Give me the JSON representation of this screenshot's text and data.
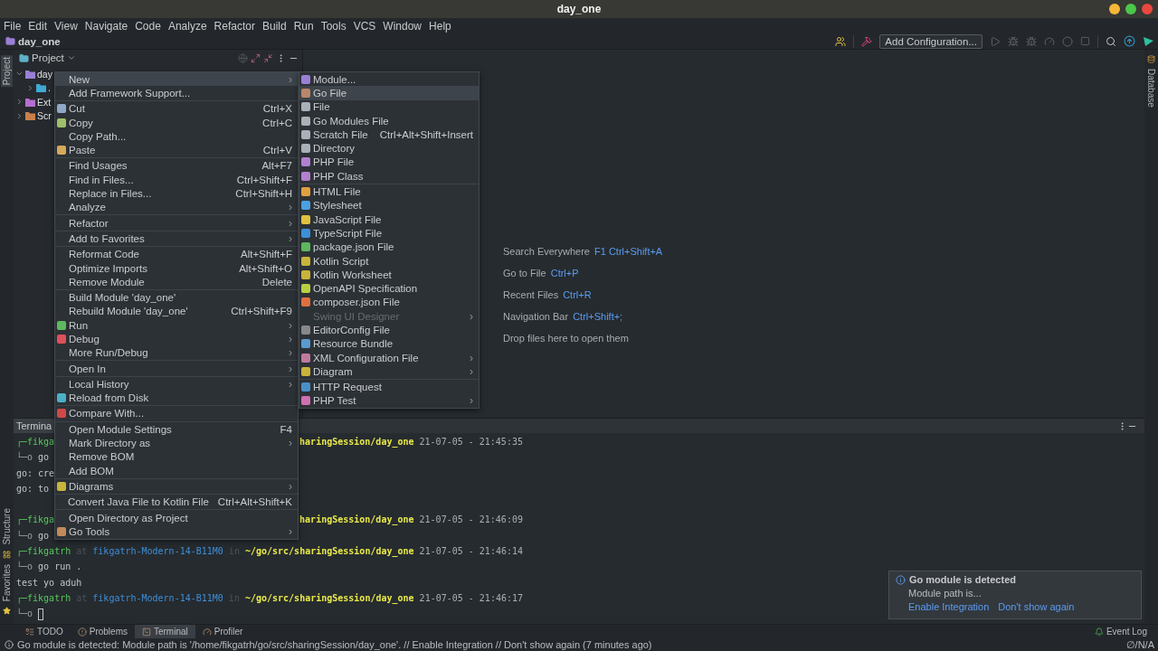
{
  "window": {
    "title": "day_one"
  },
  "menubar": [
    "File",
    "Edit",
    "View",
    "Navigate",
    "Code",
    "Analyze",
    "Refactor",
    "Build",
    "Run",
    "Tools",
    "VCS",
    "Window",
    "Help"
  ],
  "navbar": {
    "project": "day_one",
    "run_config": "Add Configuration..."
  },
  "left_strip": {
    "top": [
      {
        "label": "Project",
        "selected": true
      }
    ],
    "bottom": [
      {
        "label": "Structure",
        "selected": false
      },
      {
        "label": "Favorites",
        "selected": false
      }
    ]
  },
  "right_strip": [
    "Database"
  ],
  "project_panel": {
    "title": "Project",
    "tree": [
      {
        "label": "day",
        "expanded": true,
        "color": "#9a7fd6",
        "children": [
          {
            "label": ".",
            "expanded": false,
            "color": "#3fa9d6"
          }
        ]
      },
      {
        "label": "Ext",
        "expanded": false,
        "color": "#b56fd0"
      },
      {
        "label": "Scr",
        "expanded": false,
        "color": "#c87f4a"
      }
    ]
  },
  "editor_hints": [
    {
      "action": "Search Everywhere",
      "shortcut": "F1 Ctrl+Shift+A"
    },
    {
      "action": "Go to File",
      "shortcut": "Ctrl+P"
    },
    {
      "action": "Recent Files",
      "shortcut": "Ctrl+R"
    },
    {
      "action": "Navigation Bar",
      "shortcut": "Ctrl+Shift+;"
    },
    {
      "action": "Drop files here to open them"
    }
  ],
  "terminal": {
    "title": "Termina",
    "lines": [
      {
        "kind": "cut_prompt",
        "left": "┌─fikga",
        "path": "haringSession/day_one",
        "time": "21-07-05 - 21:45:35"
      },
      {
        "kind": "command",
        "prompt": "└─o",
        "text": "go"
      },
      {
        "kind": "output",
        "text": "go: cre"
      },
      {
        "kind": "output",
        "text": "go: to"
      },
      {
        "kind": "blank"
      },
      {
        "kind": "cut_prompt",
        "left": "┌─fikga",
        "path": "haringSession/day_one",
        "time": "21-07-05 - 21:46:09"
      },
      {
        "kind": "command",
        "prompt": "└─o",
        "text": "go"
      },
      {
        "kind": "prompt",
        "user": "┌─fikgatrh",
        "at": "at",
        "host": "fikgatrh-Modern-14-B11M0",
        "in": "in",
        "path": "~/go/src/sharingSession/day_one",
        "time": "21-07-05 - 21:46:14"
      },
      {
        "kind": "command",
        "prompt": "└─o",
        "text": "go run ."
      },
      {
        "kind": "output",
        "text": "test yo aduh"
      },
      {
        "kind": "prompt",
        "user": "┌─fikgatrh",
        "at": "at",
        "host": "fikgatrh-Modern-14-B11M0",
        "in": "in",
        "path": "~/go/src/sharingSession/day_one",
        "time": "21-07-05 - 21:46:17"
      },
      {
        "kind": "cursor",
        "prompt": "└─o"
      }
    ]
  },
  "context_menu": {
    "items": [
      {
        "kind": "item",
        "label": "New",
        "selected": true,
        "arrow": "›"
      },
      {
        "kind": "item",
        "label": "Add Framework Support...",
        "selected": false
      },
      {
        "kind": "separator"
      },
      {
        "kind": "item",
        "label": "Cut",
        "selected": false,
        "shortcut": "Ctrl+X",
        "color": "#8fa8c8"
      },
      {
        "kind": "item",
        "label": "Copy",
        "selected": false,
        "shortcut": "Ctrl+C",
        "color": "#9fbf6a"
      },
      {
        "kind": "item",
        "label": "Copy Path...",
        "selected": false
      },
      {
        "kind": "item",
        "label": "Paste",
        "selected": false,
        "shortcut": "Ctrl+V",
        "color": "#d6a85a"
      },
      {
        "kind": "separator"
      },
      {
        "kind": "item",
        "label": "Find Usages",
        "selected": false,
        "shortcut": "Alt+F7"
      },
      {
        "kind": "item",
        "label": "Find in Files...",
        "selected": false,
        "shortcut": "Ctrl+Shift+F"
      },
      {
        "kind": "item",
        "label": "Replace in Files...",
        "selected": false,
        "shortcut": "Ctrl+Shift+H"
      },
      {
        "kind": "item",
        "label": "Analyze",
        "selected": false,
        "arrow": "›"
      },
      {
        "kind": "separator"
      },
      {
        "kind": "item",
        "label": "Refactor",
        "selected": false,
        "arrow": "›"
      },
      {
        "kind": "separator"
      },
      {
        "kind": "item",
        "label": "Add to Favorites",
        "selected": false,
        "arrow": "›"
      },
      {
        "kind": "separator"
      },
      {
        "kind": "item",
        "label": "Reformat Code",
        "selected": false,
        "shortcut": "Alt+Shift+F"
      },
      {
        "kind": "item",
        "label": "Optimize Imports",
        "selected": false,
        "shortcut": "Alt+Shift+O"
      },
      {
        "kind": "item",
        "label": "Remove Module",
        "selected": false,
        "shortcut": "Delete"
      },
      {
        "kind": "separator"
      },
      {
        "kind": "item",
        "label": "Build Module 'day_one'",
        "selected": false
      },
      {
        "kind": "item",
        "label": "Rebuild Module 'day_one'",
        "selected": false,
        "shortcut": "Ctrl+Shift+F9"
      },
      {
        "kind": "item",
        "label": "Run",
        "selected": false,
        "arrow": "›",
        "color": "#5fb85f"
      },
      {
        "kind": "item",
        "label": "Debug",
        "selected": false,
        "arrow": "›",
        "color": "#e0505a"
      },
      {
        "kind": "item",
        "label": "More Run/Debug",
        "selected": false,
        "arrow": "›"
      },
      {
        "kind": "separator"
      },
      {
        "kind": "item",
        "label": "Open In",
        "selected": false,
        "arrow": "›"
      },
      {
        "kind": "separator"
      },
      {
        "kind": "item",
        "label": "Local History",
        "selected": false,
        "arrow": "›"
      },
      {
        "kind": "item",
        "label": "Reload from Disk",
        "selected": false,
        "color": "#4bb0c8"
      },
      {
        "kind": "separator"
      },
      {
        "kind": "item",
        "label": "Compare With...",
        "selected": false,
        "color": "#d04848"
      },
      {
        "kind": "separator"
      },
      {
        "kind": "item",
        "label": "Open Module Settings",
        "selected": false,
        "shortcut": "F4"
      },
      {
        "kind": "item",
        "label": "Mark Directory as",
        "selected": false,
        "arrow": "›"
      },
      {
        "kind": "item",
        "label": "Remove BOM",
        "selected": false
      },
      {
        "kind": "item",
        "label": "Add BOM",
        "selected": false
      },
      {
        "kind": "separator"
      },
      {
        "kind": "item",
        "label": "Diagrams",
        "selected": false,
        "arrow": "›",
        "color": "#c8b43a"
      },
      {
        "kind": "separator"
      },
      {
        "kind": "item",
        "label": "Convert Java File to Kotlin File",
        "selected": false,
        "shortcut": "Ctrl+Alt+Shift+K"
      },
      {
        "kind": "separator"
      },
      {
        "kind": "item",
        "label": "Open Directory as Project",
        "selected": false
      },
      {
        "kind": "item",
        "label": "Go Tools",
        "selected": false,
        "arrow": "›",
        "color": "#c08a5a"
      }
    ]
  },
  "new_submenu": {
    "items": [
      {
        "kind": "item",
        "label": "Module...",
        "selected": false,
        "disabled": false,
        "color": "#9a7fd6"
      },
      {
        "kind": "item",
        "label": "Go File",
        "selected": true,
        "disabled": false,
        "color": "#b8866a"
      },
      {
        "kind": "item",
        "label": "File",
        "selected": false,
        "disabled": false,
        "color": "#a9b0b8"
      },
      {
        "kind": "item",
        "label": "Go Modules File",
        "selected": false,
        "disabled": false,
        "color": "#a9b0b8"
      },
      {
        "kind": "item",
        "label": "Scratch File",
        "selected": false,
        "disabled": false,
        "shortcut": "Ctrl+Alt+Shift+Insert",
        "color": "#a9b0b8"
      },
      {
        "kind": "item",
        "label": "Directory",
        "selected": false,
        "disabled": false,
        "color": "#a9b0b8"
      },
      {
        "kind": "item",
        "label": "PHP File",
        "selected": false,
        "disabled": false,
        "color": "#b37fd0"
      },
      {
        "kind": "item",
        "label": "PHP Class",
        "selected": false,
        "disabled": false,
        "color": "#b37fd0"
      },
      {
        "kind": "separator"
      },
      {
        "kind": "item",
        "label": "HTML File",
        "selected": false,
        "disabled": false,
        "color": "#e0a040"
      },
      {
        "kind": "item",
        "label": "Stylesheet",
        "selected": false,
        "disabled": false,
        "color": "#4aa0e0"
      },
      {
        "kind": "item",
        "label": "JavaScript File",
        "selected": false,
        "disabled": false,
        "color": "#e0c040"
      },
      {
        "kind": "item",
        "label": "TypeScript File",
        "selected": false,
        "disabled": false,
        "color": "#3d8fd8"
      },
      {
        "kind": "item",
        "label": "package.json File",
        "selected": false,
        "disabled": false,
        "color": "#5cb85c"
      },
      {
        "kind": "item",
        "label": "Kotlin Script",
        "selected": false,
        "disabled": false,
        "color": "#c8b43a"
      },
      {
        "kind": "item",
        "label": "Kotlin Worksheet",
        "selected": false,
        "disabled": false,
        "color": "#c8b43a"
      },
      {
        "kind": "item",
        "label": "OpenAPI Specification",
        "selected": false,
        "disabled": false,
        "color": "#b8d040"
      },
      {
        "kind": "item",
        "label": "composer.json File",
        "selected": false,
        "disabled": false,
        "color": "#e07040"
      },
      {
        "kind": "item",
        "label": "Swing UI Designer",
        "selected": false,
        "disabled": true,
        "arrow": "›"
      },
      {
        "kind": "item",
        "label": "EditorConfig File",
        "selected": false,
        "disabled": false,
        "color": "#888888"
      },
      {
        "kind": "item",
        "label": "Resource Bundle",
        "selected": false,
        "disabled": false,
        "color": "#5a9ad0"
      },
      {
        "kind": "item",
        "label": "XML Configuration File",
        "selected": false,
        "disabled": false,
        "arrow": "›",
        "color": "#c07aa0"
      },
      {
        "kind": "item",
        "label": "Diagram",
        "selected": false,
        "disabled": false,
        "arrow": "›",
        "color": "#c8b43a"
      },
      {
        "kind": "separator"
      },
      {
        "kind": "item",
        "label": "HTTP Request",
        "selected": false,
        "disabled": false,
        "color": "#4a90c8"
      },
      {
        "kind": "item",
        "label": "PHP Test",
        "selected": false,
        "disabled": false,
        "arrow": "›",
        "color": "#d070b0"
      }
    ]
  },
  "bottom_tabs": [
    {
      "label": "TODO",
      "selected": false
    },
    {
      "label": "Problems",
      "selected": false
    },
    {
      "label": "Terminal",
      "selected": true
    },
    {
      "label": "Profiler",
      "selected": false
    }
  ],
  "event_log": "Event Log",
  "notification": {
    "title": "Go module is detected",
    "body": "Module path is...",
    "actions": [
      "Enable Integration",
      "Don't show again"
    ]
  },
  "status_bar": {
    "message": "Go module is detected: Module path is '/home/fikgatrh/go/src/sharingSession/day_one'. // Enable Integration // Don't show again (7 minutes ago)",
    "right": "∅/N/A"
  }
}
